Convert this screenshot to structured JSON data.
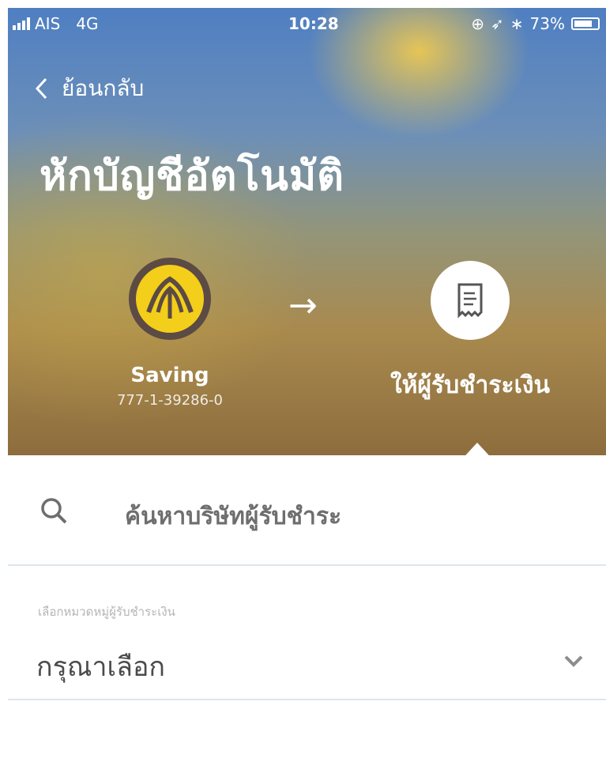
{
  "status_bar": {
    "carrier": "AIS",
    "network": "4G",
    "time": "10:28",
    "battery": "73%"
  },
  "nav": {
    "back_label": "ย้อนกลับ"
  },
  "page_title": "หักบัญชีอัตโนมัติ",
  "from_account": {
    "name": "Saving",
    "number": "777-1-39286-0",
    "logo_color": "#f3ce1a"
  },
  "to_payee": {
    "label": "ให้ผู้รับชำระเงิน",
    "icon": "receipt-icon"
  },
  "search": {
    "placeholder": "ค้นหาบริษัทผู้รับชำระ"
  },
  "category_select": {
    "label": "เลือกหมวดหมู่ผู้รับชำระเงิน",
    "value": "กรุณาเลือก"
  }
}
